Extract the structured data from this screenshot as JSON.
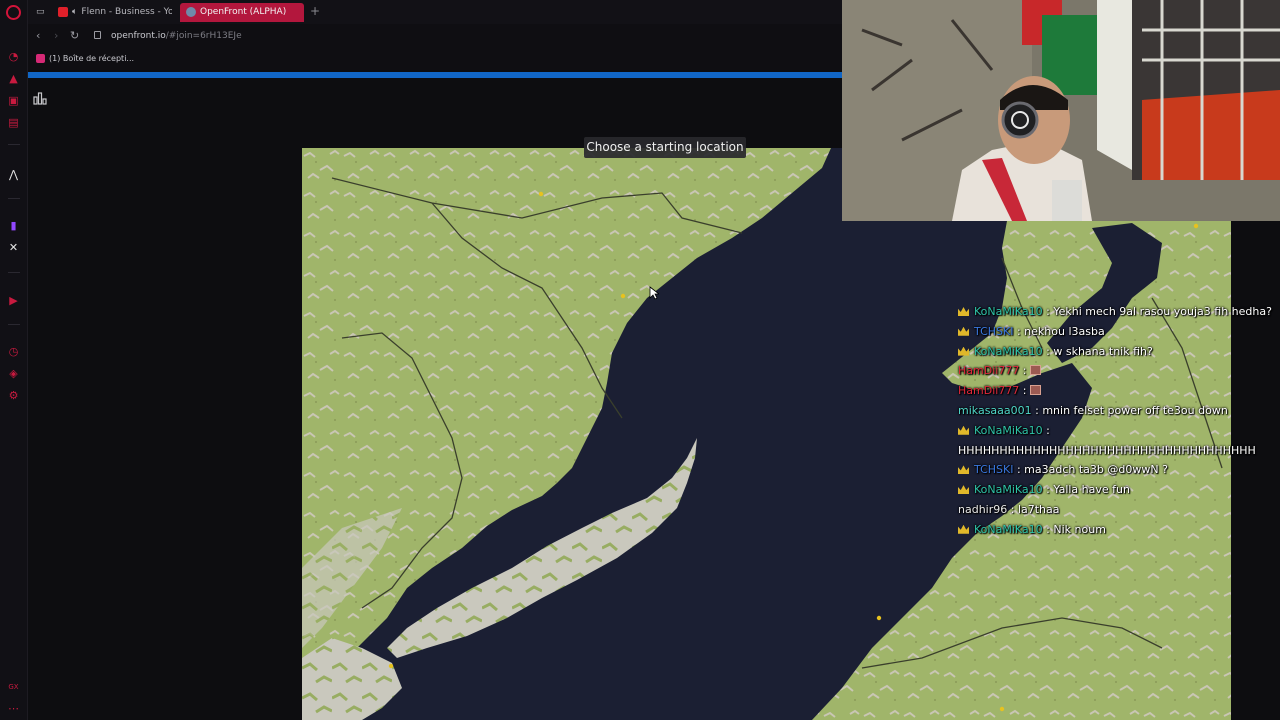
{
  "browser": {
    "tabs": [
      {
        "label": "Flenn - Business - You"
      },
      {
        "label": "OpenFront (ALPHA)"
      }
    ],
    "new_tab": "+",
    "url_host": "openfront.io",
    "url_path": "/#join=6rH13EJe",
    "bookmark": "(1) Boîte de récepti..."
  },
  "game": {
    "banner": "Choose a starting location"
  },
  "chat": [
    {
      "badge": true,
      "user": "KoNaMiKa10",
      "color": "#2fc4a8",
      "message": " : Yekhi mech 9al rasou youja3 fih hedha?"
    },
    {
      "badge": true,
      "user": "TCHSKI",
      "color": "#3a78e0",
      "message": " : nekhou l3asba"
    },
    {
      "badge": true,
      "user": "KoNaMiKa10",
      "color": "#2fc4a8",
      "message": " : w skhana tnik fih?"
    },
    {
      "badge": false,
      "user": "HamDii777",
      "color": "#e0283a",
      "message": " : ",
      "emote": true
    },
    {
      "badge": false,
      "user": "HamDii777",
      "color": "#e0283a",
      "message": " : ",
      "emote": true
    },
    {
      "badge": false,
      "user": "mikasaaa001",
      "color": "#4fd6c8",
      "message": " : mnin felset power off te3ou down"
    },
    {
      "badge": true,
      "user": "KoNaMiKa10",
      "color": "#2fc4a8",
      "message": " :"
    },
    {
      "badge": false,
      "user": "",
      "color": "#ffffff",
      "message": "HHHHHHHHHHHHHHHHHHHHHHHHHHHHHHHHHHHH"
    },
    {
      "badge": true,
      "user": "TCHSKI",
      "color": "#3a78e0",
      "message": " : ma3adch ta3b @d0wwN ?"
    },
    {
      "badge": true,
      "user": "KoNaMiKa10",
      "color": "#2fc4a8",
      "message": " : Yalla have fun"
    },
    {
      "badge": false,
      "user": "nadhir96",
      "color": "#e8e8e8",
      "message": " : la7thaa"
    },
    {
      "badge": true,
      "user": "KoNaMiKa10",
      "color": "#2fc4a8",
      "message": " : Nik noum"
    }
  ],
  "colors": {
    "accent": "#b3173d",
    "progress": "#1166c6",
    "land": "#9db264",
    "water": "#1b1f33"
  }
}
